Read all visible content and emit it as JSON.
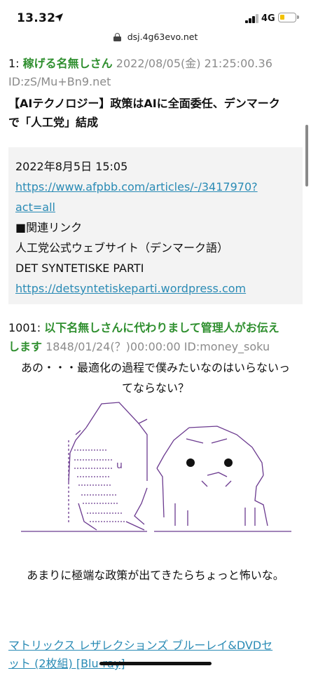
{
  "status_bar": {
    "time": "13.32",
    "network": "4G"
  },
  "url_bar": {
    "url": "dsj.4g63evo.net"
  },
  "post1": {
    "number": "1:",
    "author": "稼げる名無しさん",
    "date": "2022/08/05(金) 21:25:00.36",
    "id": "ID:zS/Mu+Bn9.net",
    "headline_line1": "【AIテクノロジー】政策はAIに全面委任、デンマーク",
    "headline_line2": "で「人工党」結成",
    "quote": {
      "datetime": "2022年8月5日 15:05",
      "link1_line1": "https://www.afpbb.com/articles/-/3417970?",
      "link1_line2": "act=all",
      "related": "■関連リンク",
      "site_label": "人工党公式ウェブサイト（デンマーク語）",
      "party_name": "DET SYNTETISKE PARTI",
      "link2": "https://detsyntetiskeparti.wordpress.com"
    }
  },
  "post1001": {
    "number": "1001:",
    "author_line1": "以下名無しさんに代わりまして管理人がお伝え",
    "author_line2": "します",
    "date": "1848/01/24(？)00:00:00",
    "id": "ID:money_soku",
    "text_line1": "あの・・・最適化の過程で僕みたいなのはいらないっ",
    "text_line2": "てならない？",
    "art_glyph": "u",
    "caption": "あまりに極端な政策が出てきたらちょっと怖いな。"
  },
  "ad": {
    "line1": "マトリックス レザレクションズ ブルーレイ&DVDセ",
    "line2": "ット (2枚組) [Blu-ray]"
  },
  "colors": {
    "author_green": "#2f8f2f",
    "link_blue": "#2a8bb5",
    "meta_gray": "#8b8b8b",
    "art_purple": "#6b3a8f"
  }
}
